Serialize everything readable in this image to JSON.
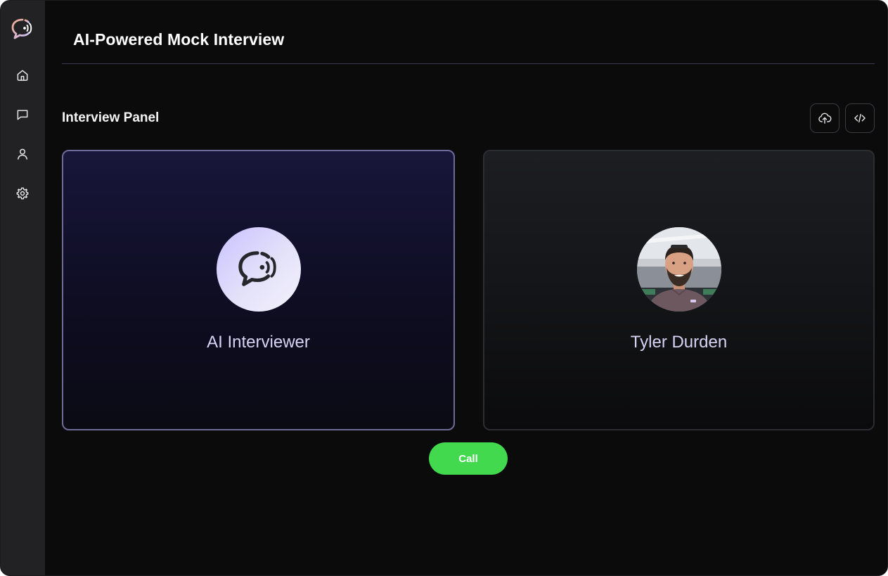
{
  "sidebar": {
    "logo_icon": "chat-voice-logo-icon",
    "logo_colors": [
      "#f2a98a",
      "#c9c2ff"
    ],
    "items": [
      {
        "name": "home",
        "icon": "home-icon"
      },
      {
        "name": "chat",
        "icon": "message-square-icon"
      },
      {
        "name": "profile",
        "icon": "user-icon"
      },
      {
        "name": "settings",
        "icon": "gear-icon"
      }
    ]
  },
  "header": {
    "title": "AI-Powered Mock Interview"
  },
  "panel": {
    "title": "Interview Panel",
    "actions": [
      {
        "name": "upload",
        "icon": "cloud-upload-icon"
      },
      {
        "name": "code",
        "icon": "code-icon"
      }
    ],
    "participants": [
      {
        "name": "AI Interviewer",
        "avatar_icon": "chat-voice-icon"
      },
      {
        "name": "Tyler Durden",
        "avatar_icon": "user-photo"
      }
    ],
    "call_label": "Call"
  },
  "colors": {
    "background": "#0b0b0c",
    "sidebar": "#222224",
    "ai_card_border": "#6f6a98",
    "call_button": "#43d94f",
    "card_name_text": "#d6d3f4"
  }
}
